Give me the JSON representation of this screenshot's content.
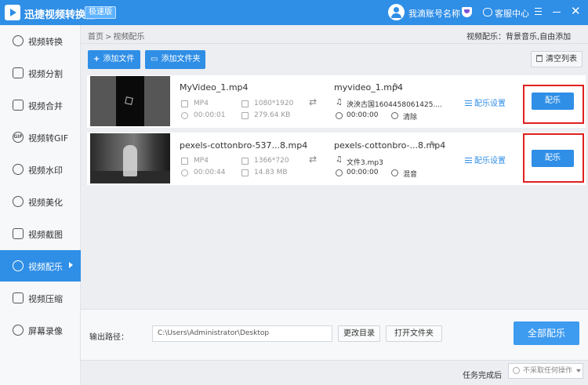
{
  "app": {
    "title": "迅捷视频转换器",
    "badge": "极速版"
  },
  "header": {
    "account": "我滴账号名称",
    "service": "客服中心"
  },
  "sidebar": {
    "items": [
      {
        "label": "视频转换",
        "icon": "refresh-icon"
      },
      {
        "label": "视频分割",
        "icon": "split-icon"
      },
      {
        "label": "视频合并",
        "icon": "play-icon"
      },
      {
        "label": "视频转GIF",
        "icon": "gif-icon",
        "icon_text": "GIF"
      },
      {
        "label": "视频水印",
        "icon": "watermark-icon"
      },
      {
        "label": "视频美化",
        "icon": "palette-icon"
      },
      {
        "label": "视频截图",
        "icon": "image-icon"
      },
      {
        "label": "视频配乐",
        "icon": "music-icon",
        "active": true
      },
      {
        "label": "视频压缩",
        "icon": "compress-icon"
      },
      {
        "label": "屏幕录像",
        "icon": "camera-icon"
      }
    ]
  },
  "breadcrumb": {
    "home": "首页",
    "sep": ">",
    "current": "视频配乐"
  },
  "mode_text": "视频配乐：背景音乐,自由添加",
  "toolbar": {
    "add_file": "添加文件",
    "add_folder": "添加文件夹",
    "clear_list": "清空列表"
  },
  "files": [
    {
      "name": "MyVideo_1.mp4",
      "format": "MP4",
      "resolution": "1080*1920",
      "duration": "00:00:01",
      "size": "279.64 KB",
      "output_name": "myvideo_1.mp4",
      "music": "泱泱古国1604458061425....",
      "out_duration": "00:00:00",
      "audio_mode": "清除",
      "setting": "配乐设置",
      "action": "配乐"
    },
    {
      "name": "pexels-cottonbro-537...8.mp4",
      "format": "MP4",
      "resolution": "1366*720",
      "duration": "00:00:44",
      "size": "14.83 MB",
      "output_name": "pexels-cottonbro-...8.mp4",
      "music": "文件3.mp3",
      "out_duration": "00:00:00",
      "audio_mode": "混音",
      "setting": "配乐设置",
      "action": "配乐"
    }
  ],
  "bottom": {
    "output_label": "输出路径：",
    "path": "C:\\Users\\Administrator\\Desktop",
    "change_dir": "更改目录",
    "open_folder": "打开文件夹",
    "all_button": "全部配乐"
  },
  "footer": {
    "after_label": "任务完成后",
    "after_value": "不采取任何操作"
  },
  "colors": {
    "accent": "#2f8ee6",
    "highlight": "#e02020"
  }
}
